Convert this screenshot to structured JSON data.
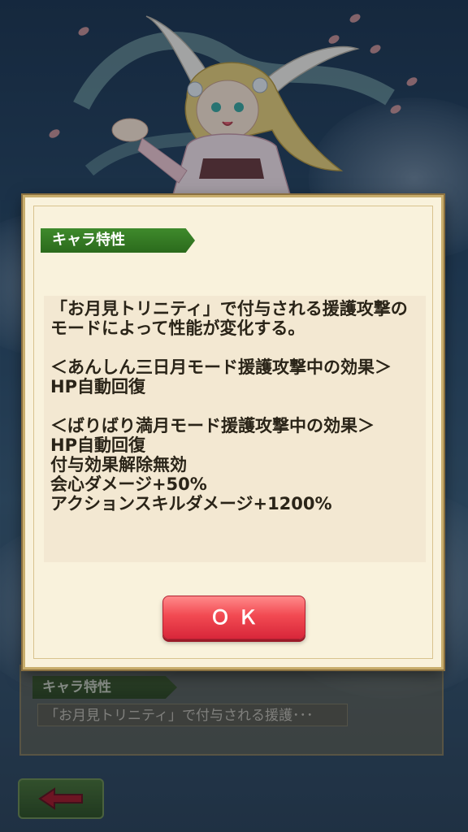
{
  "modal": {
    "section_label": "キャラ特性",
    "description": "「お月見トリニティ」で付与される援護攻撃のモードによって性能が変化する。\n\n＜あんしん三日月モード援護攻撃中の効果＞\nHP自動回復\n\n＜ばりばり満月モード援護攻撃中の効果＞\nHP自動回復\n付与効果解除無効\n会心ダメージ+50%\nアクションスキルダメージ+1200%",
    "ok_label": "ＯＫ"
  },
  "background_panel": {
    "section_label": "キャラ特性",
    "summary": "「お月見トリニティ」で付与される援護･･･"
  },
  "icons": {
    "back": "left-arrow-icon"
  },
  "colors": {
    "label_green": "#2b6a1c",
    "ok_red": "#f24a52",
    "modal_bg": "#f9f2dc"
  }
}
